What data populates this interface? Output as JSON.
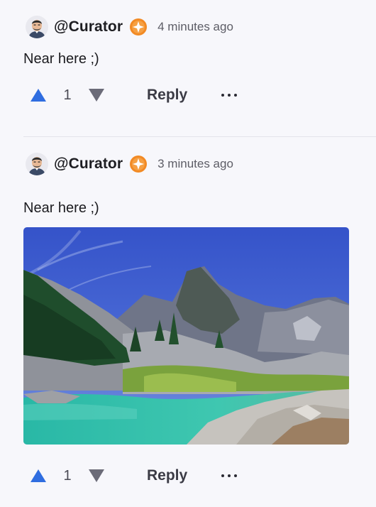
{
  "colors": {
    "upvote": "#2f6de0",
    "downvote": "#6b6b78",
    "badge": "#f28a24",
    "background": "#f7f7fb"
  },
  "comments": [
    {
      "username": "@Curator",
      "timestamp": "4 minutes ago",
      "text": "Near here ;)",
      "votes": "1",
      "reply_label": "Reply",
      "has_image": false
    },
    {
      "username": "@Curator",
      "timestamp": "3 minutes ago",
      "text": "Near here ;)",
      "votes": "1",
      "reply_label": "Reply",
      "has_image": true,
      "image_description": "mountain-lake-photo"
    }
  ],
  "icons": {
    "avatar": "avatar-icon",
    "badge": "curator-badge-icon",
    "upvote": "upvote-arrow-icon",
    "downvote": "downvote-arrow-icon",
    "more": "more-options-icon"
  }
}
